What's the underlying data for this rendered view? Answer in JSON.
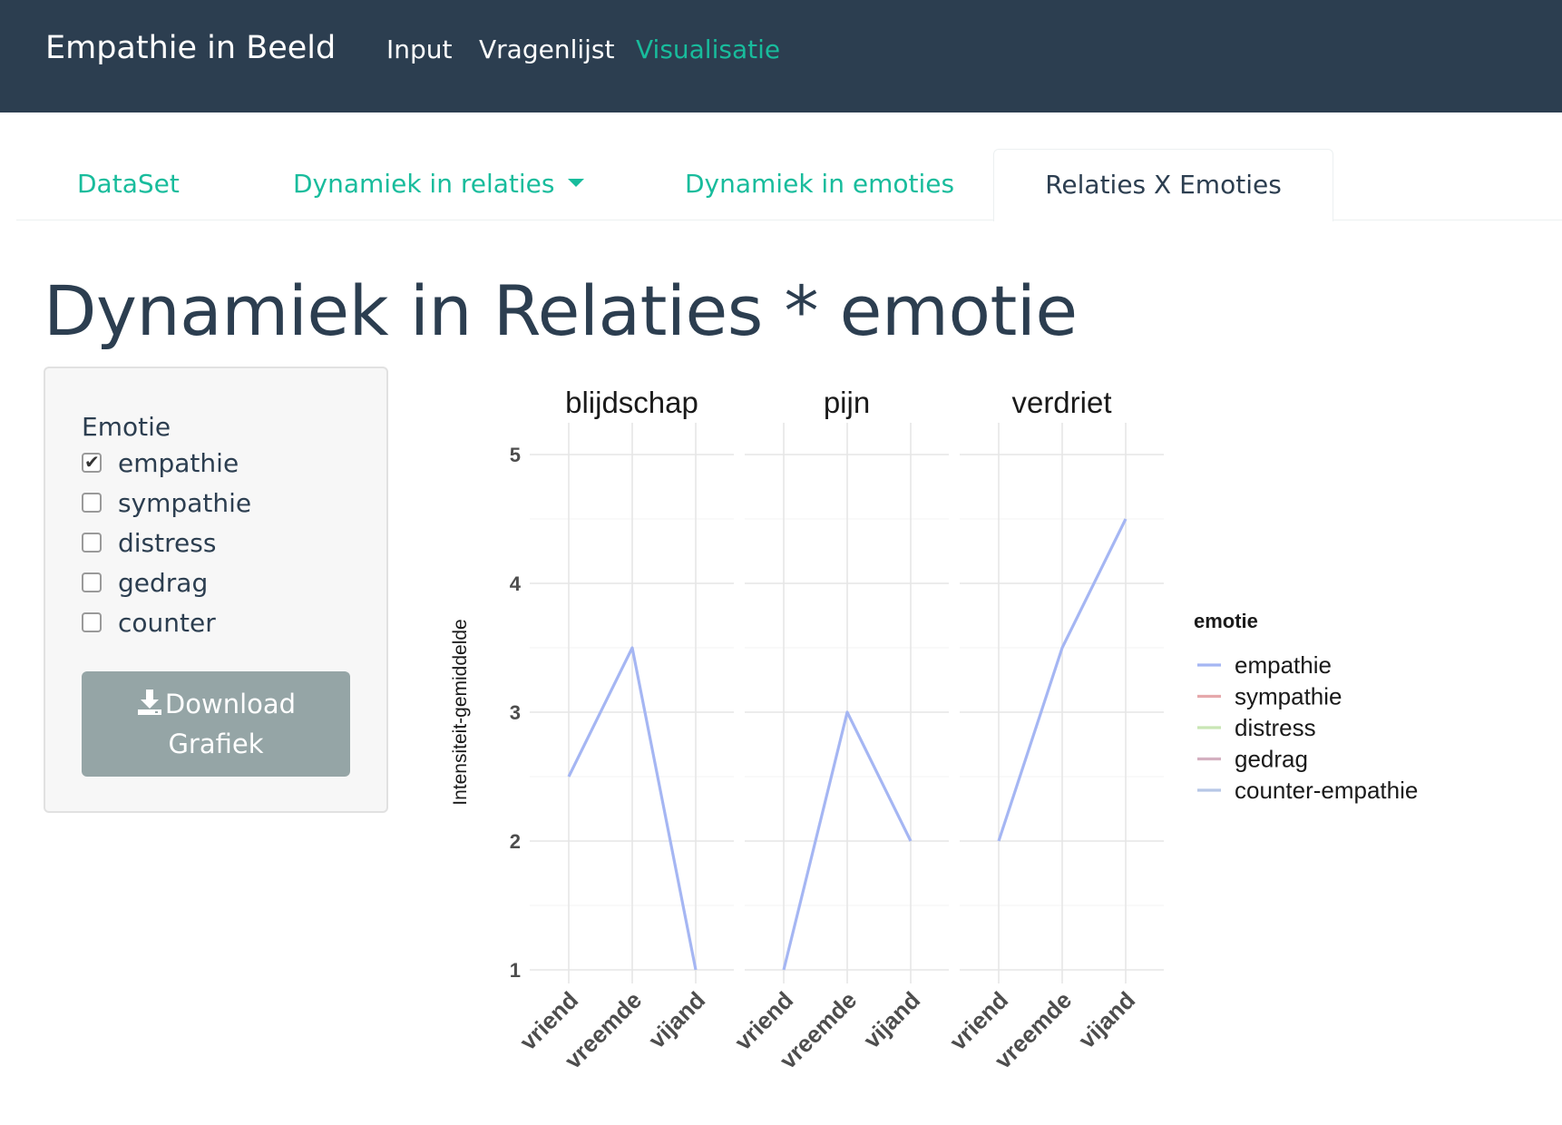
{
  "navbar": {
    "brand": "Empathie in Beeld",
    "links": [
      {
        "label": "Input",
        "active": false
      },
      {
        "label": "Vragenlijst",
        "active": false
      },
      {
        "label": "Visualisatie",
        "active": true
      }
    ]
  },
  "tabs": [
    {
      "label": "DataSet",
      "active": false
    },
    {
      "label": "Dynamiek in relaties",
      "active": false,
      "dropdown": true
    },
    {
      "label": "Dynamiek in emoties",
      "active": false
    },
    {
      "label": "Relaties X Emoties",
      "active": true
    }
  ],
  "page": {
    "title": "Dynamiek in Relaties * emotie"
  },
  "sidebar": {
    "group_label": "Emotie",
    "options": [
      {
        "label": "empathie",
        "checked": true
      },
      {
        "label": "sympathie",
        "checked": false
      },
      {
        "label": "distress",
        "checked": false
      },
      {
        "label": "gedrag",
        "checked": false
      },
      {
        "label": "counter",
        "checked": false
      }
    ],
    "download_label_line1": "Download",
    "download_label_line2": "Grafiek",
    "download_icon": "download-icon"
  },
  "colors": {
    "navbar": "#2c3e50",
    "accent": "#18bc9c",
    "button": "#95a5a6",
    "empathie": "#a5b6f3",
    "sympathie": "#e6a8ab",
    "distress": "#c9e6b5",
    "gedrag": "#d4b0c0",
    "counter-empathie": "#b7c7e6"
  },
  "chart_data": {
    "type": "line",
    "facets": [
      "blijdschap",
      "pijn",
      "verdriet"
    ],
    "categories": [
      "vriend",
      "vreemde",
      "vijand"
    ],
    "ylabel": "Intensiteit-gemiddelde",
    "yticks": [
      1,
      2,
      3,
      4,
      5
    ],
    "ylim": [
      1,
      5
    ],
    "legend_title": "emotie",
    "legend": [
      "empathie",
      "sympathie",
      "distress",
      "gedrag",
      "counter-empathie"
    ],
    "legend_placement": "right",
    "grid": true,
    "series": [
      {
        "name": "empathie",
        "values": {
          "blijdschap": [
            2.5,
            3.5,
            1.0
          ],
          "pijn": [
            1.0,
            3.0,
            2.0
          ],
          "verdriet": [
            2.0,
            3.5,
            4.5
          ]
        }
      }
    ]
  }
}
